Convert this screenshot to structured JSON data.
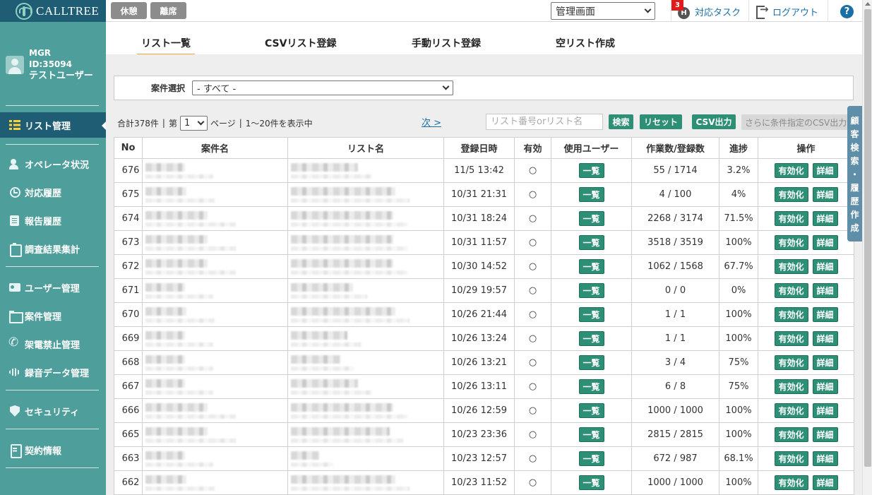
{
  "header": {
    "logo_text": "CALLTREE",
    "rest_label": "休憩",
    "away_label": "離席",
    "screen_select": "管理画面",
    "task_icon": "H",
    "task_badge": "3",
    "task_label": "対応タスク",
    "logout_label": "ログアウト",
    "help_label": "?"
  },
  "user": {
    "role": "MGR",
    "id": "ID:35094",
    "name": "テストユーザー"
  },
  "nav": {
    "list_mgmt": "リスト管理",
    "operator_status": "オペレータ状況",
    "response_history": "対応履歴",
    "report_history": "報告履歴",
    "survey_summary": "調査結果集計",
    "user_mgmt": "ユーザー管理",
    "project_mgmt": "案件管理",
    "call_block_mgmt": "架電禁止管理",
    "recording_mgmt": "録音データ管理",
    "security": "セキュリティ",
    "contract_info": "契約情報"
  },
  "tabs": {
    "list": "リスト一覧",
    "csv_register": "CSVリスト登録",
    "manual_register": "手動リスト登録",
    "empty_create": "空リスト作成"
  },
  "filter": {
    "label": "案件選択",
    "value": "- すべて -"
  },
  "pager": {
    "total": "合計378件",
    "sep1": "|",
    "page_prefix": "第",
    "page": "1",
    "page_suffix": "ページ",
    "sep2": "|",
    "range": "1～20件を表示中",
    "next": "次 >"
  },
  "search": {
    "placeholder": "リスト番号orリスト名",
    "search_label": "検索",
    "reset_label": "リセット",
    "csv_label": "CSV出力",
    "advanced_csv_label": "さらに条件指定のCSV出力"
  },
  "table": {
    "headers": [
      "No",
      "案件名",
      "リスト名",
      "登録日時",
      "有効",
      "使用ユーザー",
      "作業数/登録数",
      "進捗",
      "操作"
    ],
    "view_label": "一覧",
    "enable_label": "有効化",
    "detail_label": "詳細",
    "rows": [
      {
        "no": "676",
        "date": "11/5 13:42",
        "valid": "○",
        "work": "55 / 1714",
        "progress": "3.2%"
      },
      {
        "no": "675",
        "date": "10/31 21:31",
        "valid": "○",
        "work": "4 / 100",
        "progress": "4%"
      },
      {
        "no": "674",
        "date": "10/31 18:24",
        "valid": "○",
        "work": "2268 / 3174",
        "progress": "71.5%"
      },
      {
        "no": "673",
        "date": "10/31 11:57",
        "valid": "○",
        "work": "3518 / 3519",
        "progress": "100%"
      },
      {
        "no": "672",
        "date": "10/30 14:52",
        "valid": "○",
        "work": "1062 / 1568",
        "progress": "67.7%"
      },
      {
        "no": "671",
        "date": "10/29 19:57",
        "valid": "○",
        "work": "0 / 0",
        "progress": "0%"
      },
      {
        "no": "670",
        "date": "10/26 21:44",
        "valid": "○",
        "work": "1 / 1",
        "progress": "100%"
      },
      {
        "no": "669",
        "date": "10/26 13:24",
        "valid": "○",
        "work": "1 / 1",
        "progress": "100%"
      },
      {
        "no": "668",
        "date": "10/26 13:21",
        "valid": "○",
        "work": "3 / 4",
        "progress": "75%"
      },
      {
        "no": "667",
        "date": "10/26 13:11",
        "valid": "○",
        "work": "6 / 8",
        "progress": "75%"
      },
      {
        "no": "666",
        "date": "10/26 12:59",
        "valid": "○",
        "work": "1000 / 1000",
        "progress": "100%"
      },
      {
        "no": "665",
        "date": "10/23 23:36",
        "valid": "○",
        "work": "2815 / 2815",
        "progress": "100%"
      },
      {
        "no": "663",
        "date": "10/23 12:57",
        "valid": "○",
        "work": "672 / 987",
        "progress": "68.1%"
      },
      {
        "no": "662",
        "date": "10/23 11:52",
        "valid": "○",
        "work": "1000 / 1000",
        "progress": "100%"
      }
    ]
  },
  "side_tab": {
    "chars": [
      "顧",
      "客",
      "検",
      "索",
      "・",
      "履",
      "歴",
      "作",
      "成"
    ]
  },
  "colors": {
    "sidebar": "#4e9e9b",
    "sidebar_active": "#1e5d73",
    "button_green": "#2d8f76",
    "tab_underline": "#e8a33a",
    "link": "#1a6fa5",
    "badge": "#e01b1b"
  }
}
